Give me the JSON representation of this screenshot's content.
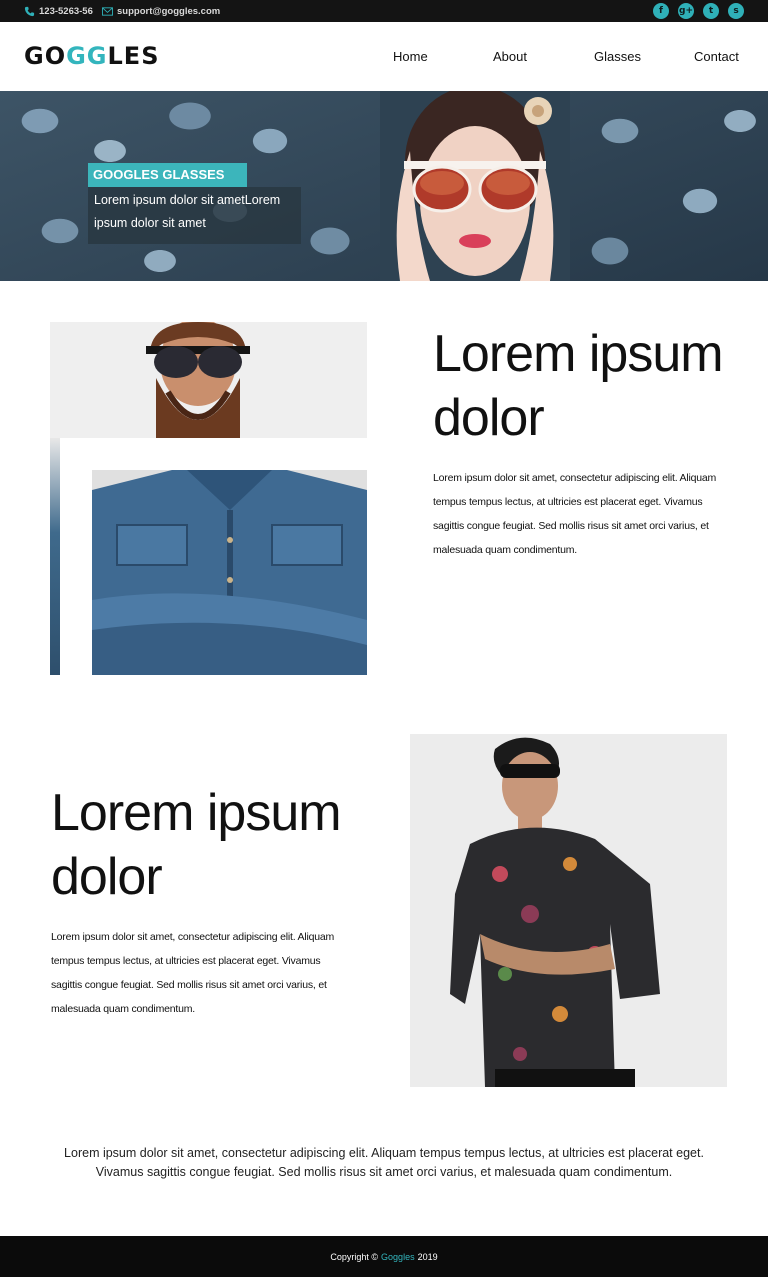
{
  "topbar": {
    "phone": "123-5263-56",
    "email": "support@goggles.com",
    "social": [
      {
        "icon": "facebook-icon",
        "glyph": "f"
      },
      {
        "icon": "google-plus-icon",
        "glyph": "g+"
      },
      {
        "icon": "twitter-icon",
        "glyph": "t"
      },
      {
        "icon": "skype-icon",
        "glyph": "s"
      }
    ]
  },
  "header": {
    "logo_part1": "GO",
    "logo_accent": "GG",
    "logo_part2": "LES",
    "nav": [
      "Home",
      "About",
      "Glasses",
      "Contact"
    ]
  },
  "hero": {
    "title": "GOOGLES GLASSES",
    "text": "Lorem ipsum dolor sit ametLorem ipsum dolor sit amet"
  },
  "section1": {
    "heading": "Lorem ipsum dolor",
    "body": "Lorem ipsum dolor sit amet, consectetur adipiscing elit. Aliquam tempus tempus lectus, at ultricies est placerat eget. Vivamus sagittis congue feugiat. Sed mollis risus sit amet orci varius, et malesuada quam condimentum."
  },
  "section2": {
    "heading": "Lorem ipsum dolor",
    "body": "Lorem ipsum dolor sit amet, consectetur adipiscing elit. Aliquam tempus tempus lectus, at ultricies est placerat eget. Vivamus sagittis congue feugiat. Sed mollis risus sit amet orci varius, et malesuada quam condimentum."
  },
  "bottom_text": "Lorem ipsum dolor sit amet, consectetur adipiscing elit. Aliquam tempus tempus lectus, at ultricies est placerat eget. Vivamus sagittis congue feugiat. Sed mollis risus sit amet orci varius, et malesuada quam condimentum.",
  "footer": {
    "prefix": "Copyright ©",
    "brand": "Goggles",
    "year": "2019"
  },
  "colors": {
    "accent": "#33b5bd",
    "topbar_bg": "#141414",
    "footer_bg": "#0b0b0b"
  }
}
